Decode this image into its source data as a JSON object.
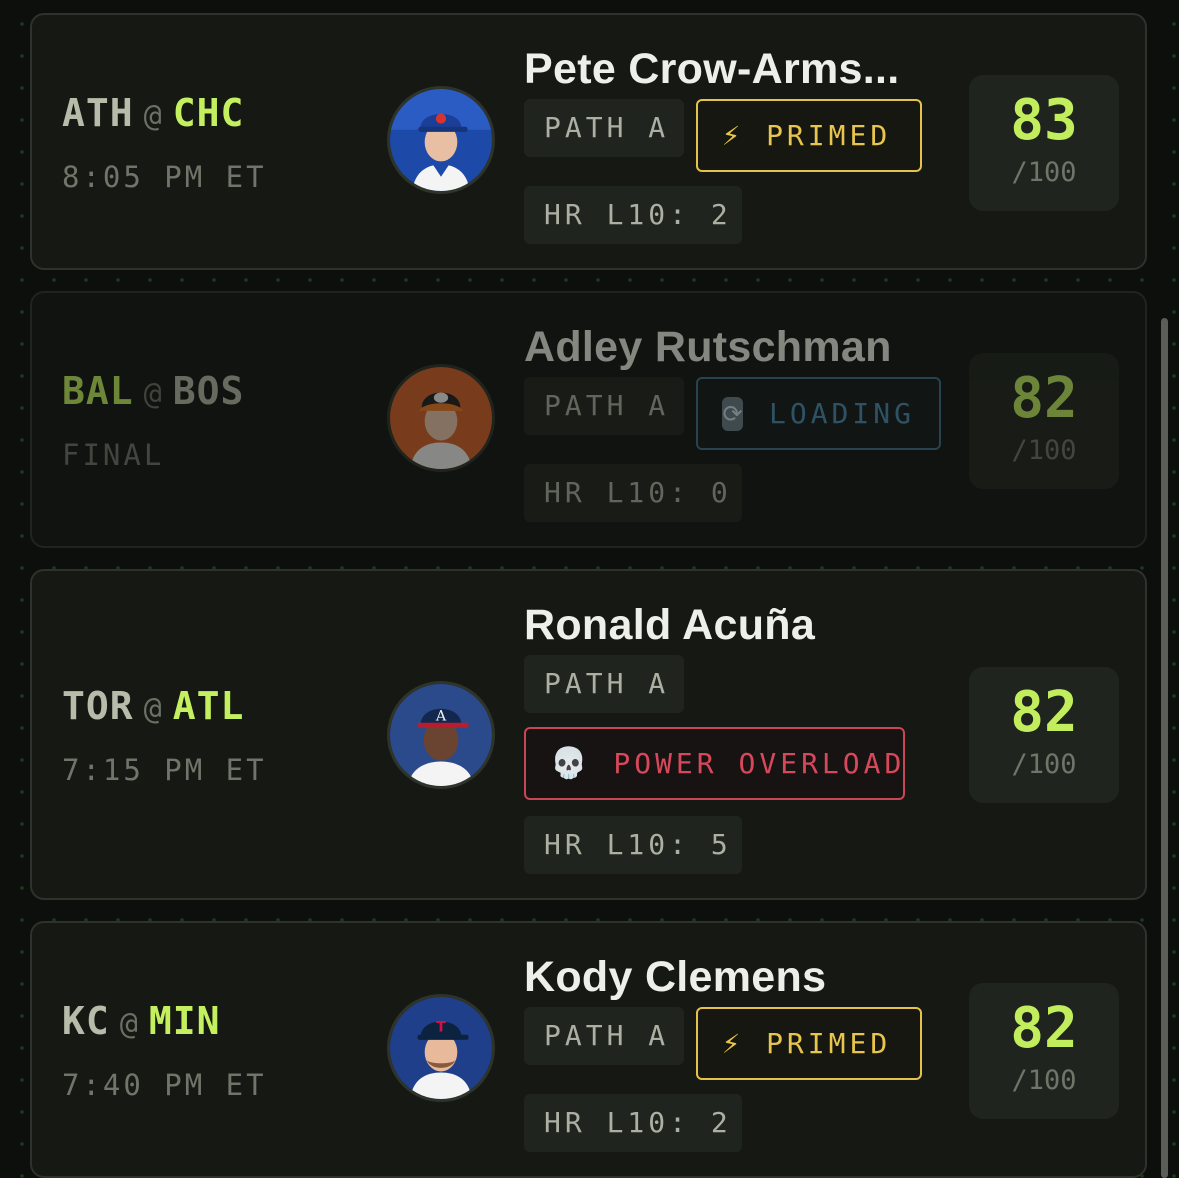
{
  "colors": {
    "background": "#0d0f0c",
    "card": "#151813",
    "accent_green": "#c4ef5f",
    "primed_yellow": "#e4c24b",
    "loading_blue": "#4b8db3",
    "overload_red": "#d6485a"
  },
  "games": [
    {
      "away": "ATH",
      "at": "@",
      "home": "CHC",
      "time": "8:05 PM ET",
      "player": "Pete Crow-Arms...",
      "path": "PATH A",
      "status": {
        "icon": "lightning-icon",
        "glyph": "⚡",
        "label": "PRIMED"
      },
      "hr": "HR L10: 2",
      "score": "83",
      "score_max": "/100",
      "team_color": "#1d4aa8"
    },
    {
      "away": "BAL",
      "at": "@",
      "home": "BOS",
      "time": "FINAL",
      "player": "Adley Rutschman",
      "path": "PATH A",
      "status": {
        "icon": "refresh-icon",
        "glyph": "⟳",
        "label": "LOADING"
      },
      "hr": "HR L10: 0",
      "score": "82",
      "score_max": "/100",
      "team_color": "#d8622a"
    },
    {
      "away": "TOR",
      "at": "@",
      "home": "ATL",
      "time": "7:15 PM ET",
      "player": "Ronald Acuña",
      "path": "PATH A",
      "status": {
        "icon": "skull-icon",
        "glyph": "💀",
        "label": "POWER OVERLOAD"
      },
      "hr": "HR L10: 5",
      "score": "82",
      "score_max": "/100",
      "team_color": "#2b4a8c"
    },
    {
      "away": "KC",
      "at": "@",
      "home": "MIN",
      "time": "7:40 PM ET",
      "player": "Kody Clemens",
      "path": "PATH A",
      "status": {
        "icon": "lightning-icon",
        "glyph": "⚡",
        "label": "PRIMED"
      },
      "hr": "HR L10: 2",
      "score": "82",
      "score_max": "/100",
      "team_color": "#1f3f8a"
    }
  ]
}
